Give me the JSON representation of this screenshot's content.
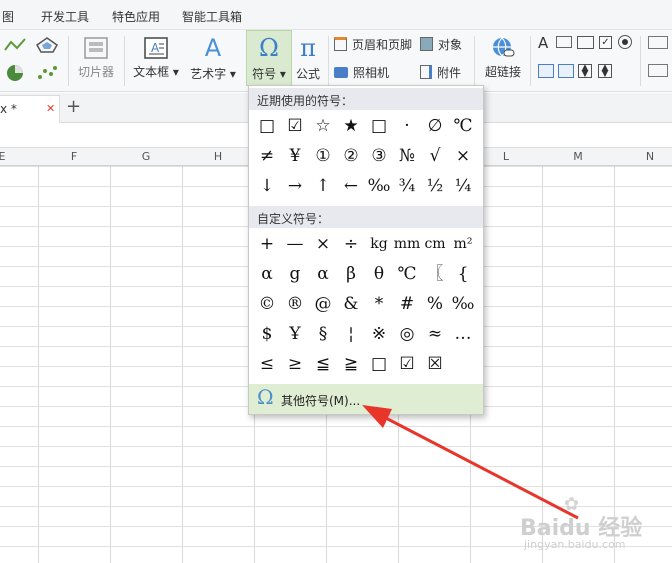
{
  "menu": {
    "items": [
      "图",
      "开发工具",
      "特色应用",
      "智能工具箱"
    ]
  },
  "ribbon": {
    "cut_shape": "切片器",
    "textbox": "文本框",
    "wordart": "艺术字",
    "symbol": "符号",
    "formula": "公式",
    "header_footer": "页眉和页脚",
    "object": "对象",
    "camera": "照相机",
    "attachment": "附件",
    "hyperlink": "超链接"
  },
  "tabs": {
    "doc_tab": "x *",
    "add_tab": "+"
  },
  "columns": [
    "E",
    "F",
    "G",
    "H",
    "I",
    "J",
    "K",
    "L",
    "M",
    "N"
  ],
  "dropdown": {
    "recent_header": "近期使用的符号：",
    "recent_symbols": [
      "□",
      "☑",
      "☆",
      "★",
      "□",
      "·",
      "∅",
      "℃",
      "≠",
      "¥",
      "①",
      "②",
      "③",
      "№",
      "√",
      "×",
      "↓",
      "→",
      "↑",
      "←",
      "‰",
      "¾",
      "½",
      "¼"
    ],
    "custom_header": "自定义符号：",
    "custom_symbols": [
      "+",
      "—",
      "×",
      "÷",
      "kg",
      "mm",
      "cm",
      "m²",
      "α",
      "g",
      "α",
      "β",
      "θ",
      "℃",
      "〖",
      "{",
      "©",
      "®",
      "@",
      "&",
      "*",
      "#",
      "%",
      "‰",
      "$",
      "Ұ",
      "§",
      "¦",
      "※",
      "◎",
      "≈",
      "…",
      "≤",
      "≥",
      "≦",
      "≧",
      "□",
      "☑",
      "☒"
    ],
    "more_label": "其他符号(M)..."
  },
  "watermark": {
    "brand": "Baidu 经验",
    "url": "jingyan.baidu.com"
  },
  "colors": {
    "highlight_green": "#dfedd3",
    "arrow_red": "#e8352a",
    "icon_blue": "#4a90c8"
  }
}
